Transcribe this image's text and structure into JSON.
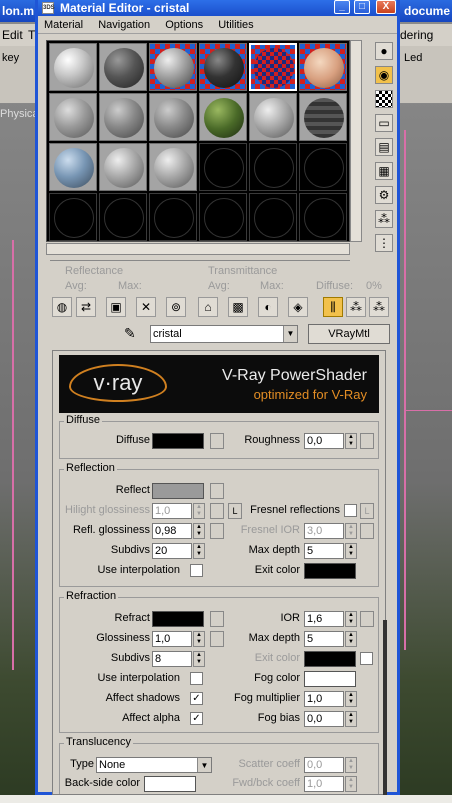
{
  "background": {
    "title_left": "lon.m",
    "title_right": "docume",
    "menu_left": "Edit",
    "menu_left2": "T",
    "menu_right": "dering",
    "menu_right2": "Led",
    "key_label": "key",
    "physical_label": "Physica"
  },
  "window": {
    "title": "Material Editor - cristal",
    "icon_text": "3DS",
    "minimize": "_",
    "maximize": "□",
    "close": "X"
  },
  "menu": [
    "Material",
    "Navigation",
    "Options",
    "Utilities"
  ],
  "toolbar_labels": {
    "reflectance": "Reflectance",
    "transmittance": "Transmittance",
    "avg1": "Avg:",
    "max1": "Max:",
    "avg2": "Avg:",
    "max2": "Max:",
    "diffuse": "Diffuse:",
    "diffuse_val": "0%"
  },
  "material": {
    "name": "cristal",
    "type": "VRayMtl"
  },
  "banner": {
    "logo": "v·ray",
    "title": "V-Ray PowerShader",
    "subtitle": "optimized for V-Ray"
  },
  "diffuse": {
    "group": "Diffuse",
    "diffuse_label": "Diffuse",
    "roughness_label": "Roughness",
    "roughness": "0,0",
    "diffuse_color": "#000000"
  },
  "reflection": {
    "group": "Reflection",
    "reflect_label": "Reflect",
    "reflect_color": "#9a9a9a",
    "hilight_label": "Hilight glossiness",
    "hilight": "1,0",
    "l_label": "L",
    "fresnel_label": "Fresnel reflections",
    "refl_gloss_label": "Refl. glossiness",
    "refl_gloss": "0,98",
    "fresnel_ior_label": "Fresnel IOR",
    "fresnel_ior": "3,0",
    "subdivs_label": "Subdivs",
    "subdivs": "20",
    "max_depth_label": "Max depth",
    "max_depth": "5",
    "interp_label": "Use interpolation",
    "exit_label": "Exit color",
    "exit_color": "#000000"
  },
  "refraction": {
    "group": "Refraction",
    "refract_label": "Refract",
    "refract_color": "#000000",
    "ior_label": "IOR",
    "ior": "1,6",
    "gloss_label": "Glossiness",
    "gloss": "1,0",
    "max_depth_label": "Max depth",
    "max_depth": "5",
    "subdivs_label": "Subdivs",
    "subdivs": "8",
    "exit_label": "Exit color",
    "exit_color": "#000000",
    "interp_label": "Use interpolation",
    "fog_color_label": "Fog color",
    "fog_color": "#ffffff",
    "affect_shadows_label": "Affect shadows",
    "fog_mult_label": "Fog multiplier",
    "fog_mult": "1,0",
    "affect_alpha_label": "Affect alpha",
    "fog_bias_label": "Fog bias",
    "fog_bias": "0,0",
    "check_mark": "✓"
  },
  "translucency": {
    "group": "Translucency",
    "type_label": "Type",
    "type_value": "None",
    "scatter_label": "Scatter coeff",
    "scatter": "0,0",
    "backside_label": "Back-side color",
    "backside_color": "#ffffff",
    "fwd_label": "Fwd/bck coeff",
    "fwd": "1,0"
  },
  "colors": {
    "titlebar": "#1a4fcc",
    "panel": "#d4d0c8",
    "vray_orange": "#e38d24"
  }
}
